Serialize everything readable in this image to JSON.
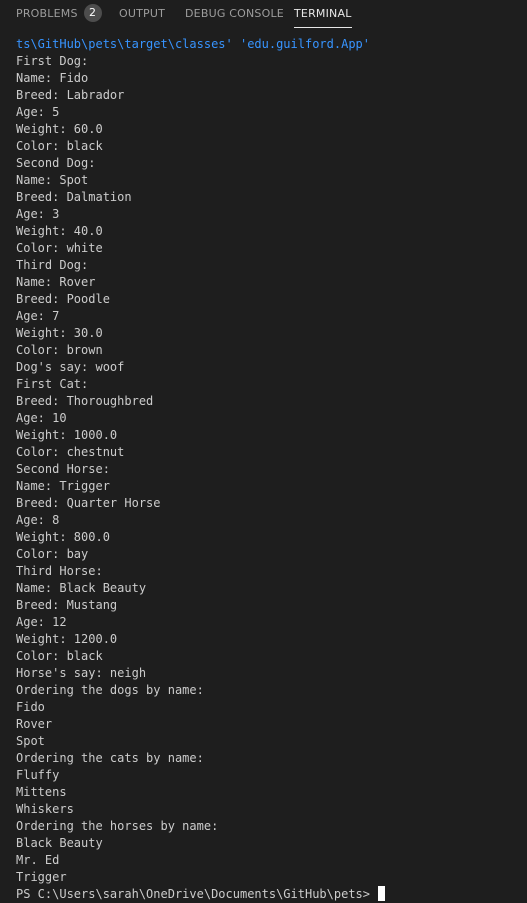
{
  "panel": {
    "tabs": [
      {
        "label": "PROBLEMS",
        "badge": "2"
      },
      {
        "label": "OUTPUT"
      },
      {
        "label": "DEBUG CONSOLE"
      },
      {
        "label": "TERMINAL",
        "active": true
      }
    ]
  },
  "terminal": {
    "command_line": "ts\\GitHub\\pets\\target\\classes' 'edu.guilford.App'",
    "lines": [
      "First Dog:",
      "Name: Fido",
      "Breed: Labrador",
      "Age: 5",
      "Weight: 60.0",
      "Color: black",
      "Second Dog:",
      "Name: Spot",
      "Breed: Dalmation",
      "Age: 3",
      "Weight: 40.0",
      "Color: white",
      "Third Dog:",
      "Name: Rover",
      "Breed: Poodle",
      "Age: 7",
      "Weight: 30.0",
      "Color: brown",
      "Dog's say: woof",
      "First Cat:",
      "Breed: Thoroughbred",
      "Age: 10",
      "Weight: 1000.0",
      "Color: chestnut",
      "Second Horse:",
      "Name: Trigger",
      "Breed: Quarter Horse",
      "Age: 8",
      "Weight: 800.0",
      "Color: bay",
      "Third Horse:",
      "Name: Black Beauty",
      "Breed: Mustang",
      "Age: 12",
      "Weight: 1200.0",
      "Color: black",
      "Horse's say: neigh",
      "Ordering the dogs by name:",
      "Fido",
      "Rover",
      "Spot",
      "Ordering the cats by name:",
      "Fluffy",
      "Mittens",
      "Whiskers",
      "Ordering the horses by name:",
      "Black Beauty",
      "Mr. Ed",
      "Trigger"
    ],
    "prompt": "PS C:\\Users\\sarah\\OneDrive\\Documents\\GitHub\\pets> "
  },
  "colors": {
    "background": "#1e1e1e",
    "text": "#cccccc",
    "command": "#3794ff",
    "tab_inactive": "#9d9d9d",
    "tab_active": "#e7e7e7",
    "badge_bg": "#4d4d4d"
  }
}
